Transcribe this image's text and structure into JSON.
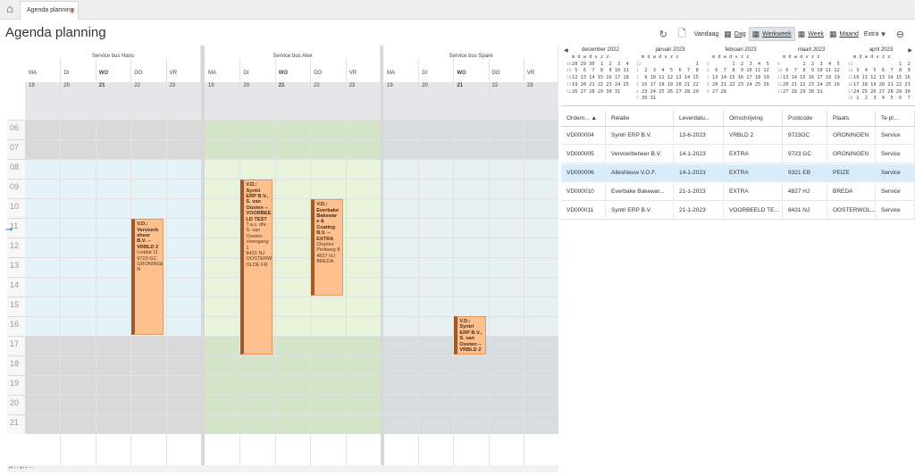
{
  "tab": {
    "title": "Agenda planning",
    "close": "×"
  },
  "page_title": "Agenda planning",
  "toolbar": {
    "vandaag": "Vandaag",
    "dag": "Dag",
    "werkweek": "Werkweek",
    "week": "Week",
    "maand": "Maand",
    "extra": "Extra"
  },
  "hours": [
    "06",
    "07",
    "08",
    "09",
    "10",
    "11",
    "12",
    "13",
    "14",
    "15",
    "16",
    "17",
    "18",
    "19",
    "20",
    "21"
  ],
  "groups": [
    {
      "name": "Service bus Hans"
    },
    {
      "name": "Service bus Alex"
    },
    {
      "name": "Service bus Spare"
    }
  ],
  "days": [
    {
      "label": "MA",
      "date": "19"
    },
    {
      "label": "DI",
      "date": "20"
    },
    {
      "label": "WO",
      "date": "21"
    },
    {
      "label": "DO",
      "date": "22"
    },
    {
      "label": "VR",
      "date": "23"
    }
  ],
  "appointments": [
    {
      "lines": [
        "V.D.: Vervoerb eheer B.V. -- VRBLD 2",
        "Lintdal 11",
        "9723 GC",
        "GRONINGE N"
      ]
    },
    {
      "lines": [
        "V.D.: Syntri ERP B.V., S. van Oosten -- VOORBEE LD TEST",
        "T.a.v. dhr. S. van Oosten",
        "Veengang 1",
        "8431 NJ",
        "OOSTERW OLDE FR"
      ]
    },
    {
      "lines": [
        "V.D.: Everbake Bakewar e & Coating B.V. -- EXTRA",
        "Charles Petitweg 8",
        "4827 HJ",
        "BREDA"
      ]
    },
    {
      "lines": [
        "V.D.: Syntri ERP B.V., S. van Oosten -- VRBLD 2"
      ]
    }
  ],
  "mini_months": [
    {
      "title": "december 2022",
      "rows": [
        "m d w d v z z",
        "28 29 30  1  2  3  4",
        " 5  6  7  8  9 10 11",
        "12 13 14 15 16 17 18",
        "19 20 21 22 23 24 25",
        "26 27 28 29 30 31"
      ],
      "weeks": [
        "48",
        "49",
        "50",
        "51",
        "52"
      ]
    },
    {
      "title": "januari 2023",
      "rows": [
        "m d w d v z z",
        "                   1",
        " 2  3  4  5  6  7  8",
        " 9 10 11 12 13 14 15",
        "16 17 18 19 20 21 22",
        "23 24 25 26 27 28 29",
        "30 31"
      ],
      "weeks": [
        "52",
        "1",
        "2",
        "3",
        "4",
        "5"
      ]
    },
    {
      "title": "februari 2023",
      "rows": [
        "m d w d v z z",
        "       1  2  3  4  5",
        " 6  7  8  9 10 11 12",
        "13 14 15 16 17 18 19",
        "20 21 22 23 24 25 26",
        "27 28"
      ],
      "weeks": [
        "5",
        "6",
        "7",
        "8",
        "9"
      ]
    },
    {
      "title": "maart 2023",
      "rows": [
        "m d w d v z z",
        "       1  2  3  4  5",
        " 6  7  8  9 10 11 12",
        "13 14 15 16 17 18 19",
        "20 21 22 23 24 25 26",
        "27 28 29 30 31"
      ],
      "weeks": [
        "9",
        "10",
        "11",
        "12",
        "13"
      ]
    },
    {
      "title": "april 2023",
      "rows": [
        "m d w d v z z",
        "                1  2",
        " 3  4  5  6  7  8  9",
        "10 11 12 13 14 15 16",
        "17 18 19 20 21 22 23",
        "24 25 26 27 28 29 30",
        " 1  2  3  4  5  6  7"
      ],
      "weeks": [
        "13",
        "14",
        "15",
        "16",
        "17",
        "18"
      ]
    }
  ],
  "grid": {
    "headers": [
      "Ordern... ▲",
      "Relatie",
      "Leverdatu...",
      "Omschrijving",
      "Postcode",
      "Plaats",
      "Te pl..."
    ],
    "rows": [
      [
        "VD000004",
        "Syntri ERP B.V.",
        "13-6-2023",
        "VRBLD 2",
        "9723GC",
        "GRONINGEN",
        "Service"
      ],
      [
        "VD000005",
        "Vervoerbeheer B.V.",
        "14-1-2023",
        "EXTRA",
        "9723 GC",
        "GRONINGEN",
        "Service"
      ],
      [
        "VD000006",
        "Alleshieuw V.O.F.",
        "14-1-2023",
        "EXTRA",
        "9321 EB",
        "PEIZE",
        "Service"
      ],
      [
        "VD000010",
        "Everbake Bakewar...",
        "21-1-2023",
        "EXTRA",
        "4827 HJ",
        "BREDA",
        "Service"
      ],
      [
        "VD000011",
        "Syntri ERP B.V.",
        "21-1-2023",
        "VOORBEELD TE...",
        "8431 NJ",
        "OOSTERWOL...",
        "Service"
      ]
    ],
    "selected_row": 2
  },
  "colors": {
    "hans": "#e4f3f8",
    "alex": "#e8f4d9",
    "spare": "#e7f0f4",
    "hans_off": "#d9d9d9",
    "alex_off": "#d4e4c6",
    "spare_off": "#d5dde1",
    "appt": "#ffc08f",
    "appt_border": "#a0592a"
  }
}
